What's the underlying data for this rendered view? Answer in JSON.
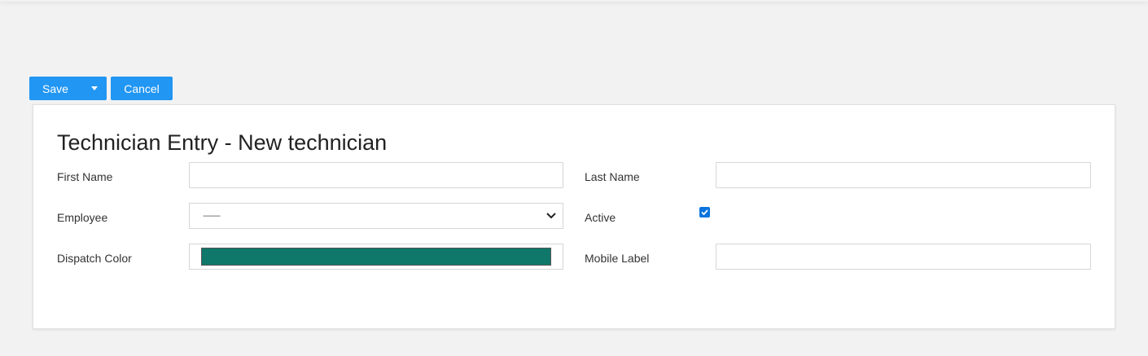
{
  "toolbar": {
    "save_label": "Save",
    "cancel_label": "Cancel"
  },
  "form": {
    "title": "Technician Entry - New technician",
    "first_name": {
      "label": "First Name",
      "value": ""
    },
    "last_name": {
      "label": "Last Name",
      "value": ""
    },
    "employee": {
      "label": "Employee",
      "selected": "---------"
    },
    "active": {
      "label": "Active",
      "checked": true
    },
    "dispatch_color": {
      "label": "Dispatch Color",
      "color": "#10776b"
    },
    "mobile_label": {
      "label": "Mobile Label",
      "value": ""
    }
  },
  "colors": {
    "accent": "#2196f3",
    "background": "#f2f2f2",
    "card": "#ffffff"
  }
}
